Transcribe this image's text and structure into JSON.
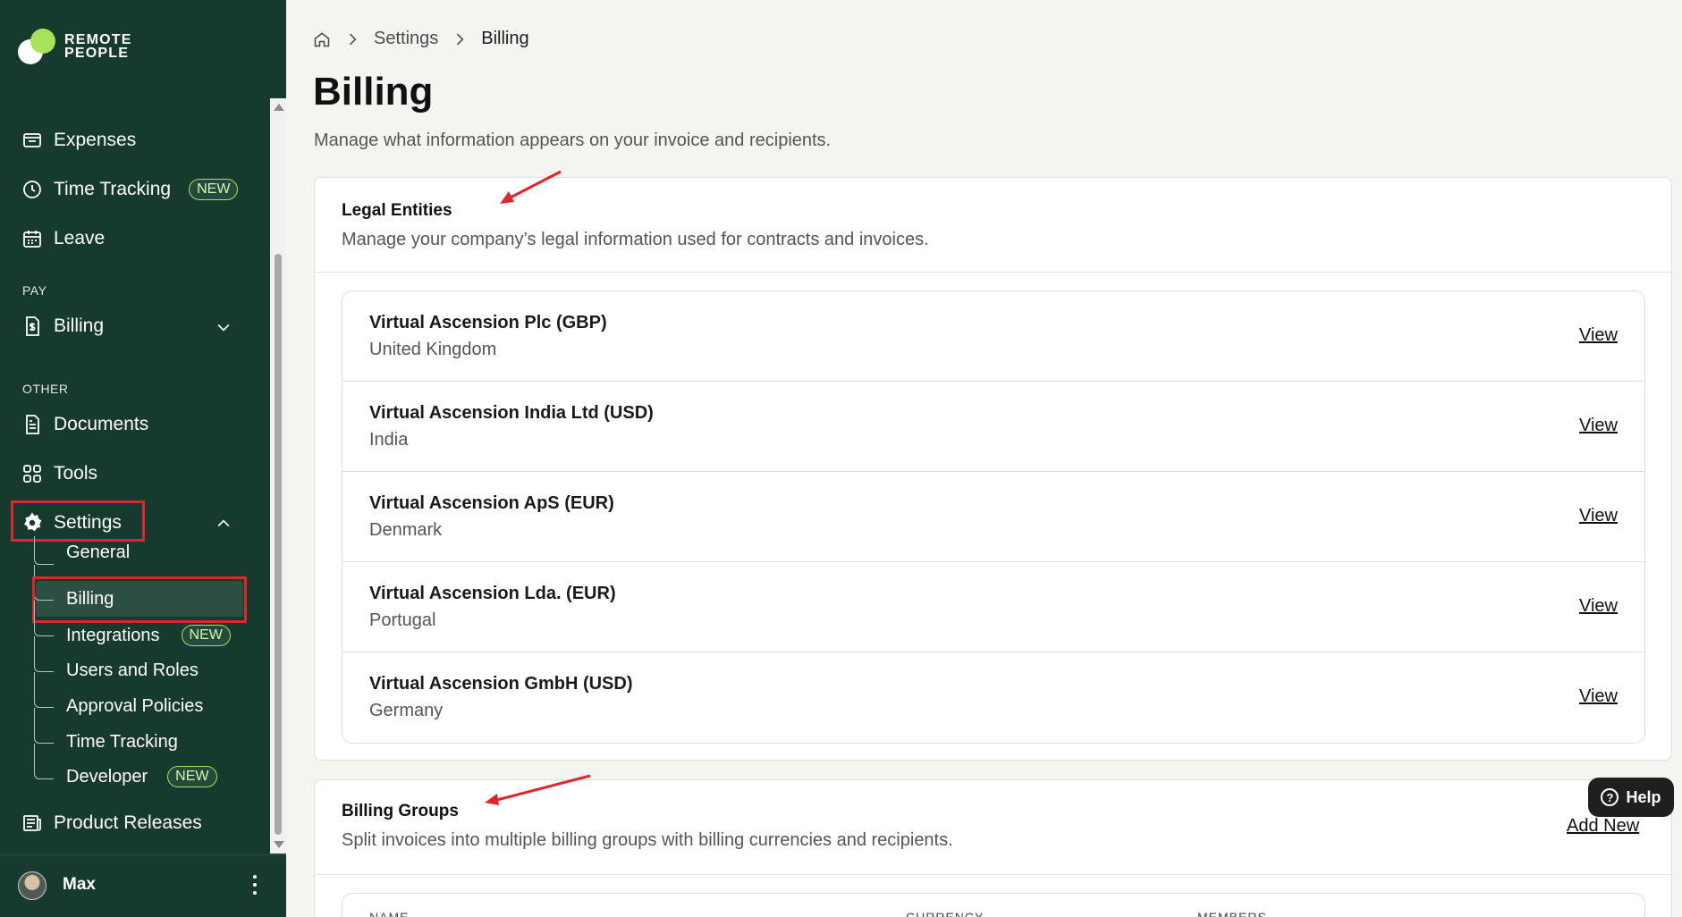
{
  "brand": {
    "line1": "REMOTE",
    "line2": "PEOPLE"
  },
  "sidebar": {
    "items": [
      {
        "label": "Expenses"
      },
      {
        "label": "Time Tracking",
        "badge": "NEW"
      },
      {
        "label": "Leave"
      }
    ],
    "pay_label": "PAY",
    "billing": {
      "label": "Billing"
    },
    "other_label": "OTHER",
    "other_items": [
      {
        "label": "Documents"
      },
      {
        "label": "Tools"
      }
    ],
    "settings": {
      "label": "Settings",
      "children": [
        {
          "label": "General"
        },
        {
          "label": "Billing"
        },
        {
          "label": "Integrations",
          "badge": "NEW"
        },
        {
          "label": "Users and Roles"
        },
        {
          "label": "Approval Policies"
        },
        {
          "label": "Time Tracking"
        },
        {
          "label": "Developer",
          "badge": "NEW"
        }
      ]
    },
    "product_releases": "Product Releases",
    "user": {
      "name": "Max"
    }
  },
  "breadcrumb": {
    "items": [
      "Settings",
      "Billing"
    ]
  },
  "page": {
    "title": "Billing",
    "subtitle": "Manage what information appears on your invoice and recipients."
  },
  "legal_entities": {
    "title": "Legal Entities",
    "description": "Manage your company’s legal information used for contracts and invoices.",
    "view_label": "View",
    "entities": [
      {
        "name": "Virtual Ascension Plc (GBP)",
        "country": "United Kingdom"
      },
      {
        "name": "Virtual Ascension India Ltd (USD)",
        "country": "India"
      },
      {
        "name": "Virtual Ascension ApS (EUR)",
        "country": "Denmark"
      },
      {
        "name": "Virtual Ascension Lda. (EUR)",
        "country": "Portugal"
      },
      {
        "name": "Virtual Ascension GmbH (USD)",
        "country": "Germany"
      }
    ]
  },
  "billing_groups": {
    "title": "Billing Groups",
    "description": "Split invoices into multiple billing groups with billing currencies and recipients.",
    "add_new": "Add New",
    "columns": [
      "NAME",
      "CURRENCY",
      "MEMBERS"
    ]
  },
  "help": {
    "label": "Help"
  },
  "colors": {
    "sidebar_bg": "#163a2e",
    "accent": "#a6e35a",
    "annotation_red": "#e0262b"
  }
}
